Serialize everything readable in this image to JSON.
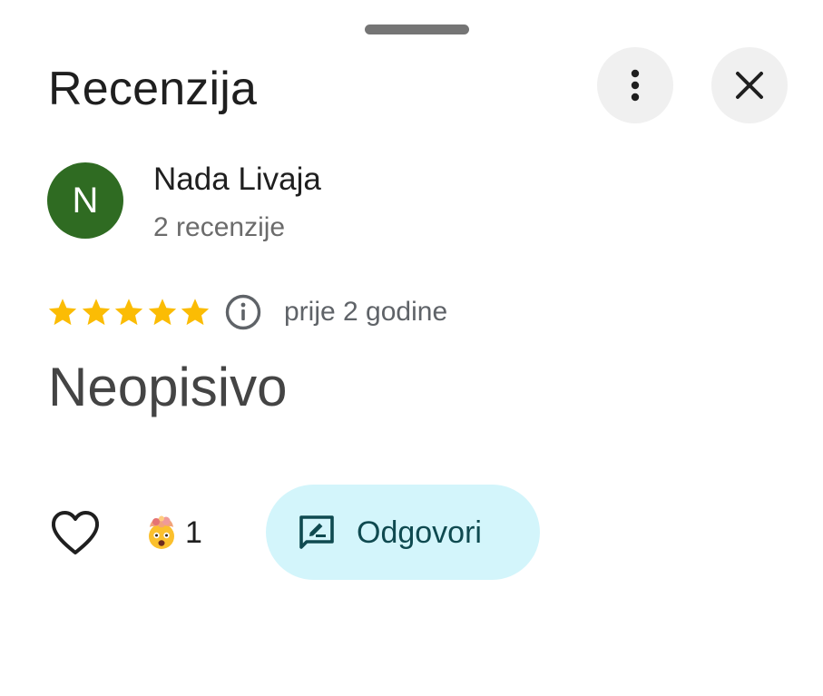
{
  "sheet": {
    "title": "Recenzija"
  },
  "reviewer": {
    "initial": "N",
    "avatar_color": "#2f6b22",
    "name": "Nada Livaja",
    "review_count": "2 recenzije"
  },
  "review": {
    "rating": 5,
    "rating_max": 5,
    "star_color": "#fbbc04",
    "time": "prije 2 godine",
    "text": "Neopisivo"
  },
  "actions": {
    "like_icon": "heart-outline-icon",
    "reaction_emoji": "exploding-head-emoji",
    "reaction_count": "1",
    "reply_label": "Odgovori",
    "reply_bg_color": "#d3f5fb"
  },
  "header_buttons": {
    "more_icon": "more-vert-icon",
    "close_icon": "close-icon"
  }
}
